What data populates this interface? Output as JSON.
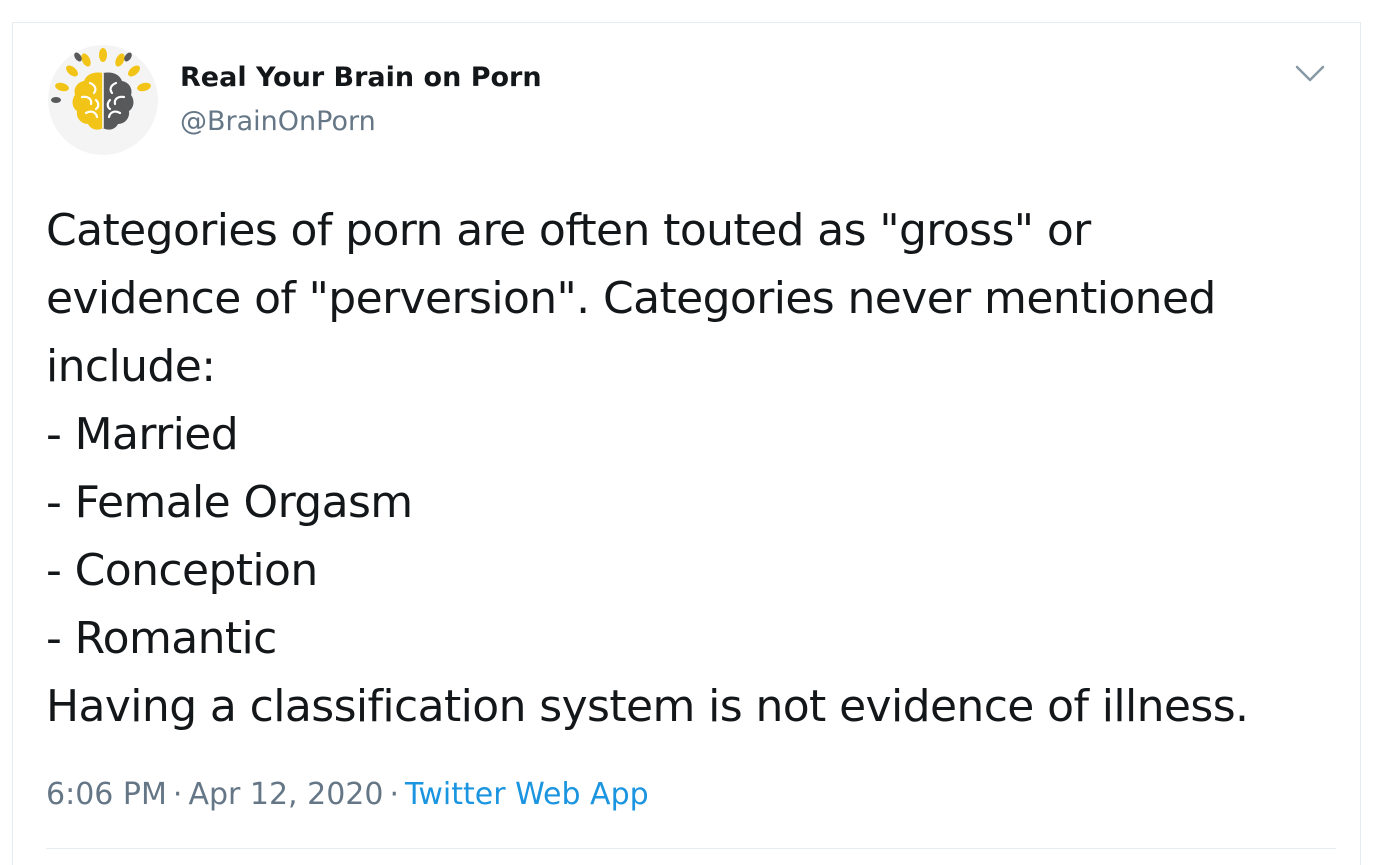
{
  "tweet": {
    "author": {
      "display_name": "Real Your Brain on Porn",
      "handle": "@BrainOnPorn",
      "avatar_icon": "brain-sun-logo-icon"
    },
    "menu_icon": "chevron-down-icon",
    "text_lines": [
      "Categories of porn are often touted as \"gross\" or",
      "evidence of \"perversion\". Categories never mentioned",
      "include:",
      "- Married",
      "- Female Orgasm",
      "- Conception",
      "- Romantic",
      "Having a classification system is not evidence of illness."
    ],
    "time": "6:06 PM",
    "date": "Apr 12, 2020",
    "separator": "·",
    "source": "Twitter Web App"
  },
  "colors": {
    "text_primary": "#14171a",
    "text_secondary": "#657786",
    "link": "#1b95e0",
    "border": "#e6ecf0",
    "logo_yellow": "#f2c417",
    "logo_gray": "#58595b"
  }
}
